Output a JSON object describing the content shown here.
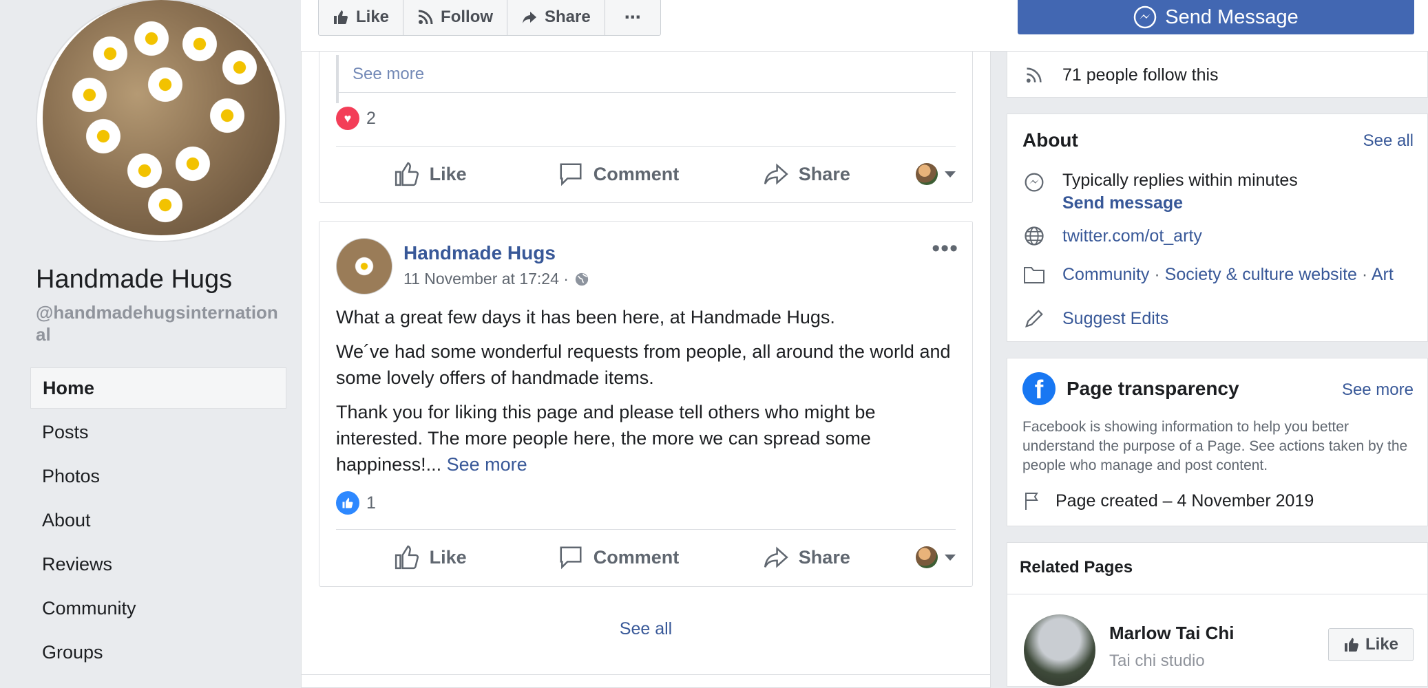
{
  "page": {
    "name": "Handmade Hugs",
    "handle": "@handmadehugsinternational"
  },
  "nav": [
    {
      "label": "Home",
      "active": true
    },
    {
      "label": "Posts"
    },
    {
      "label": "Photos"
    },
    {
      "label": "About"
    },
    {
      "label": "Reviews"
    },
    {
      "label": "Community"
    },
    {
      "label": "Groups"
    }
  ],
  "top_actions": {
    "like": "Like",
    "follow": "Follow",
    "share": "Share",
    "more": "⋯",
    "send_message": "Send Message"
  },
  "post1": {
    "see_more": "See more",
    "reaction_count": "2",
    "actions": {
      "like": "Like",
      "comment": "Comment",
      "share": "Share"
    }
  },
  "post2": {
    "author": "Handmade Hugs",
    "timestamp": "11 November at 17:24 ·",
    "paragraphs": [
      "What a great few days it has been here, at Handmade Hugs.",
      "We´ve had some wonderful requests from people, all around the world and some lovely offers of handmade items.",
      "Thank you for liking this page and please tell others who might be interested. The more people here, the more we can spread some happiness!..."
    ],
    "see_more": "See more",
    "reaction_count": "1",
    "actions": {
      "like": "Like",
      "comment": "Comment",
      "share": "Share"
    }
  },
  "center": {
    "see_all": "See all"
  },
  "right": {
    "followers": "71 people follow this",
    "about": {
      "title": "About",
      "see_all": "See all",
      "replies": "Typically replies within minutes",
      "send_message": "Send message",
      "website": "twitter.com/ot_arty",
      "categories": [
        "Community",
        "Society & culture website",
        "Art"
      ],
      "suggest_edits": "Suggest Edits"
    },
    "transparency": {
      "title": "Page transparency",
      "see_more": "See more",
      "text": "Facebook is showing information to help you better understand the purpose of a Page. See actions taken by the people who manage and post content.",
      "created": "Page created – 4 November 2019"
    },
    "related": {
      "title": "Related Pages",
      "items": [
        {
          "name": "Marlow Tai Chi",
          "category": "Tai chi studio",
          "like": "Like"
        }
      ]
    }
  },
  "colors": {
    "facebook_blue": "#4267b2",
    "link": "#385898",
    "love": "#f33e58",
    "like": "#2d88ff"
  }
}
